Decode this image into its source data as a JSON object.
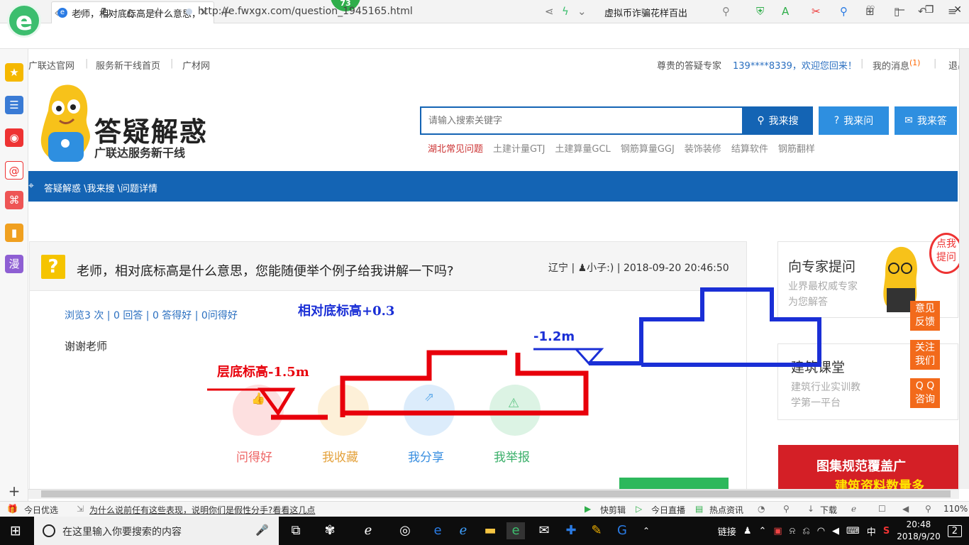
{
  "browser": {
    "tab_title": "老师，相对底标高是什么意思，您",
    "badge": "73",
    "url": "http://e.fwxgx.com/question_1945165.html",
    "search_text": "虚拟币诈骗花样百出"
  },
  "topnav": {
    "left": [
      "广联达官网",
      "服务新干线首页",
      "广材网"
    ],
    "expert": "尊贵的答疑专家",
    "welcome": "139****8339，欢迎您回来！",
    "messages": "我的消息",
    "messages_count": "(1)",
    "logout": "退出"
  },
  "header": {
    "brand_title": "答疑解惑",
    "brand_sub": "广联达服务新干线",
    "search_placeholder": "请输入搜索关键字",
    "btn_search": "我来搜",
    "btn_ask": "我来问",
    "btn_answer": "我来答",
    "hot_links": [
      "湖北常见问题",
      "土建计量GTJ",
      "土建算量GCL",
      "钢筋算量GGJ",
      "装饰装修",
      "结算软件",
      "钢筋翻样"
    ]
  },
  "breadcrumb": "答疑解惑 \\我来搜 \\问题详情",
  "question": {
    "title": "老师，相对底标高是什么意思，您能随便举个例子给我讲解一下吗?",
    "meta": "辽宁 | ♟小子:) | 2018-09-20 20:46:50",
    "stats": "浏览3 次 | 0 回答 | 0 答得好 | 0问得好",
    "body": "谢谢老师"
  },
  "actions": [
    "问得好",
    "我收藏",
    "我分享",
    "我举报"
  ],
  "annotations": {
    "relative": "相对底标高+0.3",
    "level": "-1.2m",
    "floor": "层底标高-1.5m"
  },
  "sidebar": {
    "ask_title": "向专家提问",
    "ask_sub": "业界最权威专家\n为您解答",
    "course_title": "建筑课堂",
    "course_sub": "建筑行业实训教\n学第一平台",
    "feedback": "意见\n反馈",
    "follow": "关注\n我们",
    "qq": "Q Q\n咨询",
    "bubble": "点我\n提问",
    "banner_line1": "图集规范覆盖广",
    "banner_line2": "建筑资料数量多"
  },
  "statusbar": {
    "left1": "今日优选",
    "news": "为什么说前任有这些表现，说明你们是假性分手?看看这几点",
    "items": [
      "快剪辑",
      "今日直播",
      "热点资讯"
    ],
    "download": "下载",
    "zoom": "110%"
  },
  "taskbar": {
    "search_placeholder": "在这里输入你要搜索的内容",
    "link": "链接",
    "ime": "中",
    "time": "20:48",
    "date": "2018/9/20",
    "notif": "2"
  },
  "colors": {
    "brand_blue": "#1464b4",
    "button_blue": "#2e8fe0",
    "annot_red": "#e8000b",
    "annot_blue": "#1a2fd6",
    "browser_green": "#3cbe6e"
  }
}
